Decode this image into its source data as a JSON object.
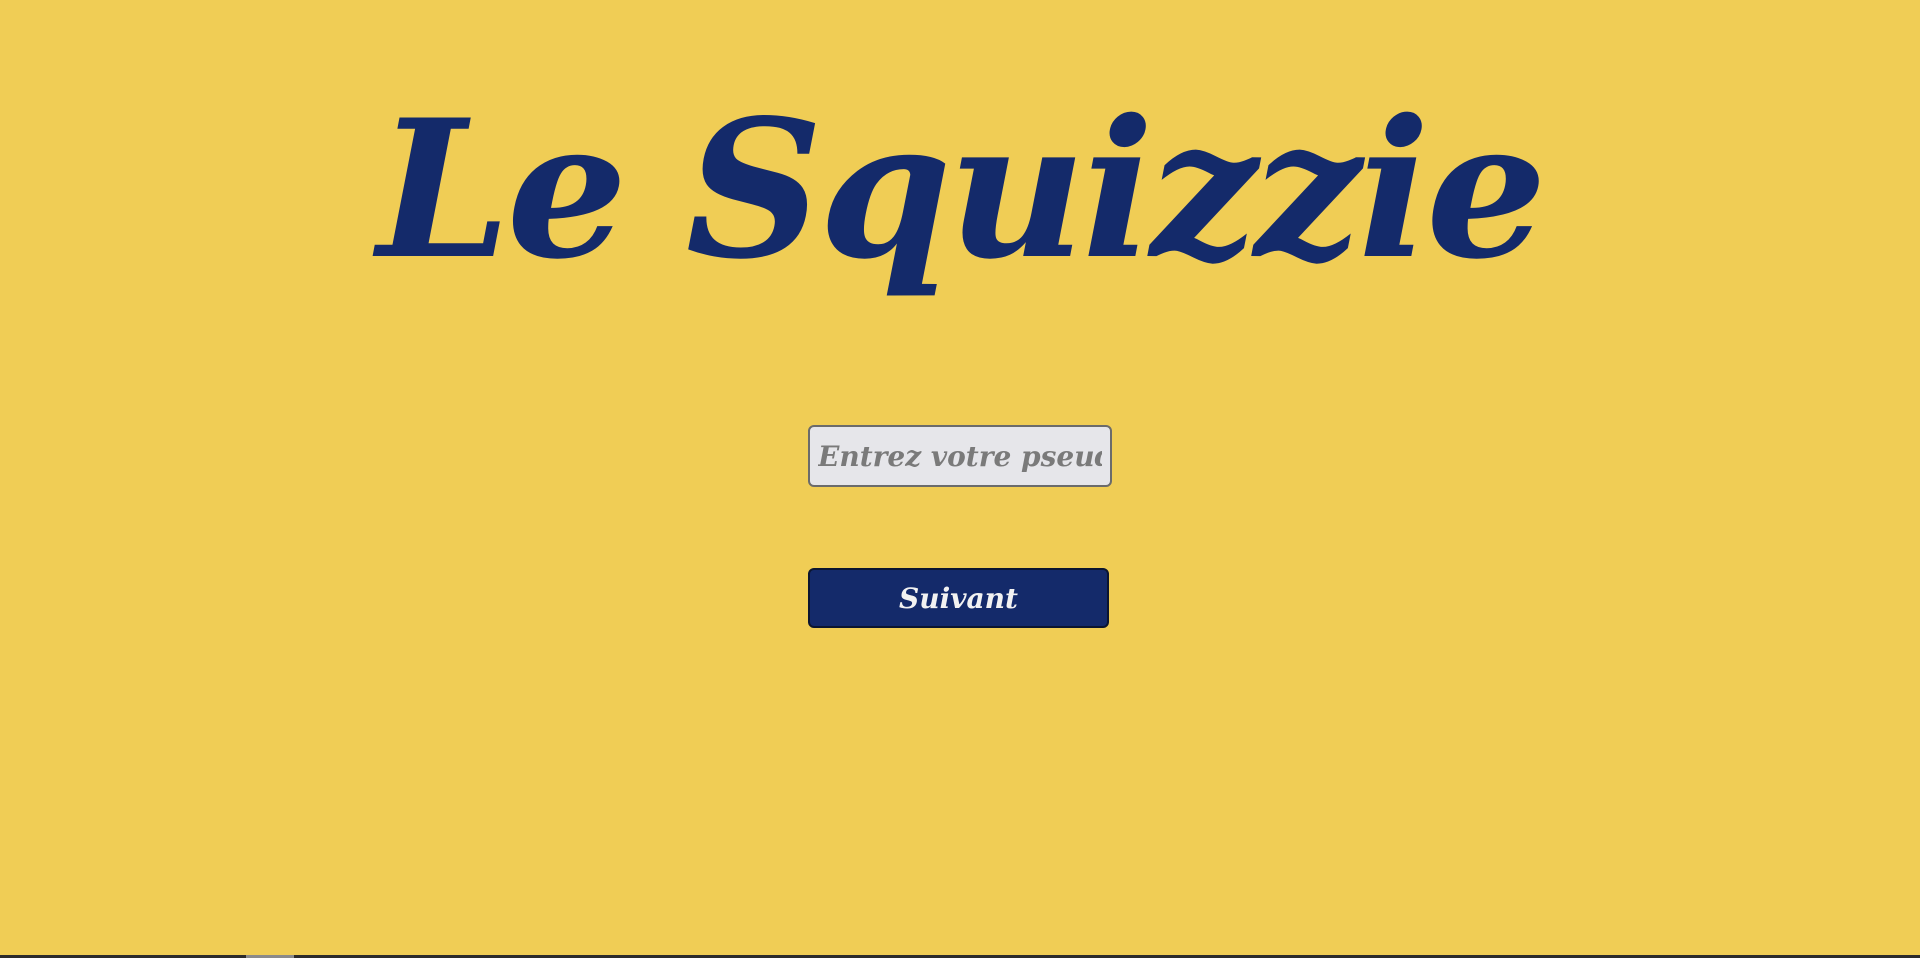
{
  "page": {
    "title": "Le Squizzie"
  },
  "form": {
    "pseudo_placeholder": "Entrez votre pseudo",
    "pseudo_value": "",
    "next_label": "Suivant"
  },
  "colors": {
    "background": "#f0cd55",
    "accent": "#142a6a",
    "input_background": "#e6e6ea",
    "button_text": "#f2f2f2"
  }
}
